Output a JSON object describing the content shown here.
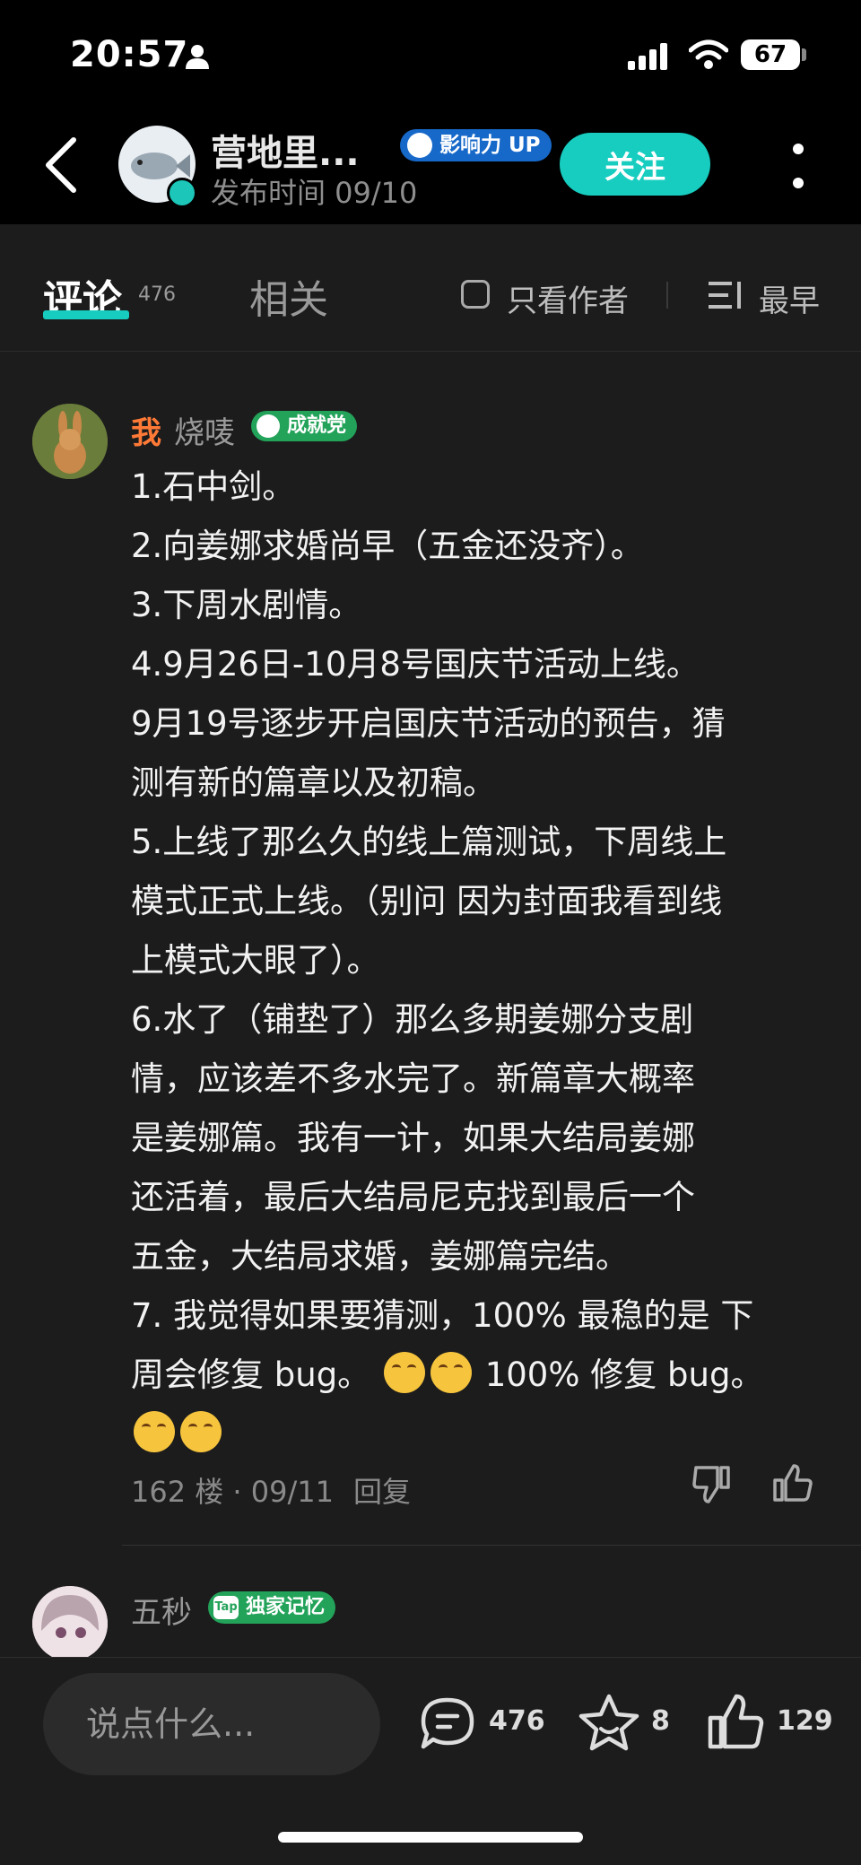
{
  "status_bar": {
    "time": "20:57",
    "battery": "67",
    "icons": [
      "person-icon",
      "signal-icon",
      "wifi-icon",
      "battery-icon"
    ]
  },
  "header": {
    "author_name": "营地里...",
    "author_badge": "影响力 UP",
    "post_time": "发布时间 09/10",
    "follow_label": "关注",
    "accent_color": "#16cdc0"
  },
  "tabs": {
    "comments_label": "评论",
    "comments_count": "476",
    "related_label": "相关",
    "author_only_label": "只看作者",
    "sort_label": "最早"
  },
  "comments": [
    {
      "me_label": "我",
      "user": "烧唛",
      "badge": "成就党",
      "lines": [
        "1.石中剑。",
        "2.向姜娜求婚尚早（五金还没齐）。",
        "3.下周水剧情。",
        "4.9月26日-10月8号国庆节活动上线。",
        "9月19号逐步开启国庆节活动的预告，猜",
        "测有新的篇章以及初稿。",
        "5.上线了那么久的线上篇测试，下周线上",
        "模式正式上线。（别问 因为封面我看到线",
        "上模式大眼了）。",
        "6.水了（铺垫了）那么多期姜娜分支剧",
        "情，应该差不多水完了。新篇章大概率",
        "是姜娜篇。我有一计，如果大结局姜娜",
        "还活着，最后大结局尼克找到最后一个",
        "五金，大结局求婚，姜娜篇完结。",
        "7. 我觉得如果要猜测，100% 最稳的是 下",
        "周会修复 bug。",
        "100% 修复 bug。"
      ],
      "meta": "162 楼 · 09/11",
      "reply_label": "回复"
    },
    {
      "user": "五秒",
      "badge": "独家记忆",
      "badge_icon_text": "Tap"
    }
  ],
  "bottom_bar": {
    "input_placeholder": "说点什么...",
    "comment_count": "476",
    "star_count": "8",
    "like_count": "129"
  }
}
